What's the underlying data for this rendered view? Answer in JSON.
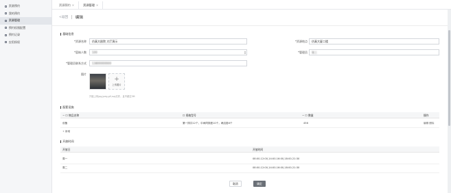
{
  "sidebar": {
    "items": [
      {
        "label": "资源预约"
      },
      {
        "label": "我的预约"
      },
      {
        "label": "资源管理"
      },
      {
        "label": "预约权限配置"
      },
      {
        "label": "预约记录"
      },
      {
        "label": "应用授权"
      }
    ]
  },
  "tabs": [
    {
      "label": "资源预约"
    },
    {
      "label": "资源管理"
    }
  ],
  "header": {
    "back": "<返回",
    "title": "编辑"
  },
  "basic": {
    "section": "基础信息",
    "name_label": "*资源名称",
    "name_value": "仿真大剧院 大厅演示",
    "location_label": "*资源地点",
    "location_value": "仿真大厦二楼",
    "capacity_label": "*容纳人数",
    "capacity_value": "100",
    "admin_label": "*管理员",
    "admin_value": "张三",
    "contact_label": "*管理员联系方式",
    "contact_value": "13800000000",
    "image_label": "图片",
    "upload_label": "上传图片",
    "hint": "只能上传jpg,jpeg,gif,svg文件，且不超过5M"
  },
  "equipment": {
    "section": "配套设施",
    "headers": [
      "物品名称",
      "规格型号",
      "数量",
      "操作"
    ],
    "rows": [
      {
        "name": "设备",
        "spec": "第一排共12个，中间同排座10个，两边各6个",
        "qty": "456",
        "ops": "编辑 删除"
      }
    ],
    "add": "+ 新增"
  },
  "opening": {
    "section": "开放时间",
    "headers": [
      "开放日",
      "开放时间"
    ],
    "rows": [
      {
        "day": "周一",
        "time": "08:00-12:00,14:00-16:00,18:00-21:30"
      },
      {
        "day": "周二",
        "time": "08:00-12:00,14:00-16:00,18:00-21:30"
      }
    ]
  },
  "actions": {
    "cancel": "取消",
    "confirm": "确定"
  },
  "colors": {
    "primary_button": "#6b7077",
    "active_nav": "#e3e6eb"
  }
}
